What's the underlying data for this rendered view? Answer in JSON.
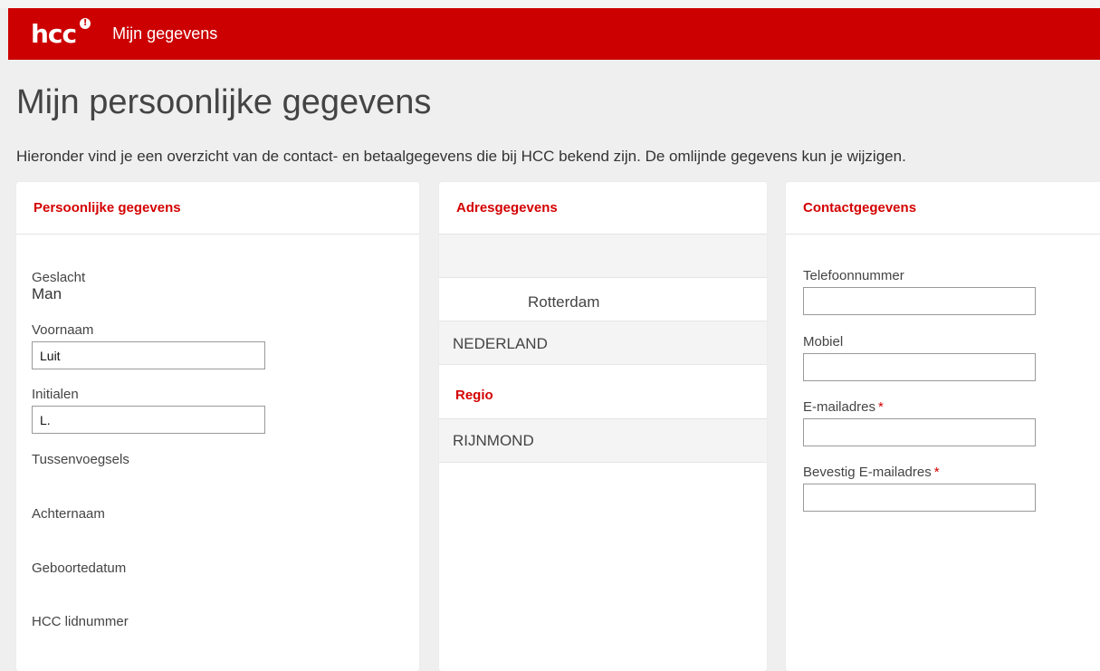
{
  "header": {
    "logo": "hcc",
    "logo_badge": "!",
    "nav_link": "Mijn gegevens"
  },
  "page": {
    "title": "Mijn persoonlijke gegevens",
    "intro": "Hieronder vind je een overzicht van de contact- en betaalgegevens die bij HCC bekend zijn. De omlijnde gegevens kun je wijzigen."
  },
  "personal": {
    "title": "Persoonlijke gegevens",
    "gender_label": "Geslacht",
    "gender_value": "Man",
    "firstname_label": "Voornaam",
    "firstname_value": "Luit",
    "initials_label": "Initialen",
    "initials_value": "L.",
    "infix_label": "Tussenvoegsels",
    "lastname_label": "Achternaam",
    "birthdate_label": "Geboortedatum",
    "member_label": "HCC lidnummer"
  },
  "address": {
    "title": "Adresgegevens",
    "city": "Rotterdam",
    "country": "NEDERLAND",
    "region_title": "Regio",
    "region": "RIJNMOND"
  },
  "contact": {
    "title": "Contactgegevens",
    "phone_label": "Telefoonnummer",
    "phone_value": "",
    "mobile_label": "Mobiel",
    "mobile_value": "",
    "email_label": "E-mailadres",
    "email_value": "",
    "confirm_label": "Bevestig E-mailadres",
    "confirm_value": "",
    "required_mark": "*"
  },
  "colors": {
    "brand": "#cc0000",
    "heading": "#d40000",
    "background": "#efefef"
  }
}
